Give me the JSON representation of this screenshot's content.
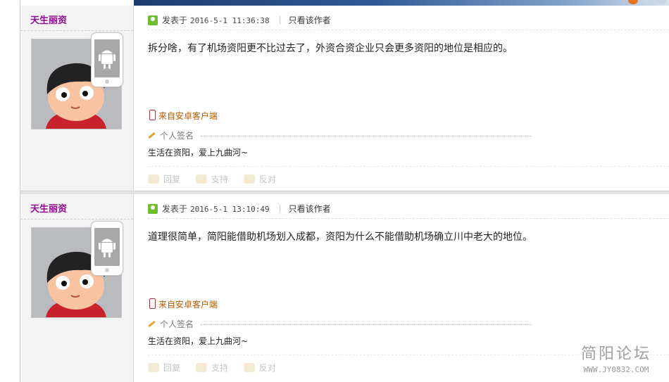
{
  "colors": {
    "username": "#8c0f8e",
    "device_link": "#b35a00",
    "accent": "#6ebd2f"
  },
  "posts": [
    {
      "username": "天生丽资",
      "posted_label": "发表于",
      "time": "2016-5-1 11:36:38",
      "author_only": "只看该作者",
      "message": "拆分啥，有了机场资阳更不比过去了，外资合资企业只会更多资阳的地位是相应的。",
      "device": "来自安卓客户端",
      "signature_label": "个人签名",
      "signature": "生活在资阳，爱上九曲河~",
      "actions": {
        "reply": "回复",
        "support": "支持",
        "oppose": "反对"
      }
    },
    {
      "username": "天生丽资",
      "posted_label": "发表于",
      "time": "2016-5-1 13:10:49",
      "author_only": "只看该作者",
      "message": "道理很简单，简阳能借助机场划入成都，资阳为什么不能借助机场确立川中老大的地位。",
      "device": "来自安卓客户端",
      "signature_label": "个人签名",
      "signature": "生活在资阳，爱上九曲河~",
      "actions": {
        "reply": "回复",
        "support": "支持",
        "oppose": "反对"
      }
    }
  ],
  "watermark": {
    "title": "简阳论坛",
    "url": "WWW.JY0832.COM"
  }
}
